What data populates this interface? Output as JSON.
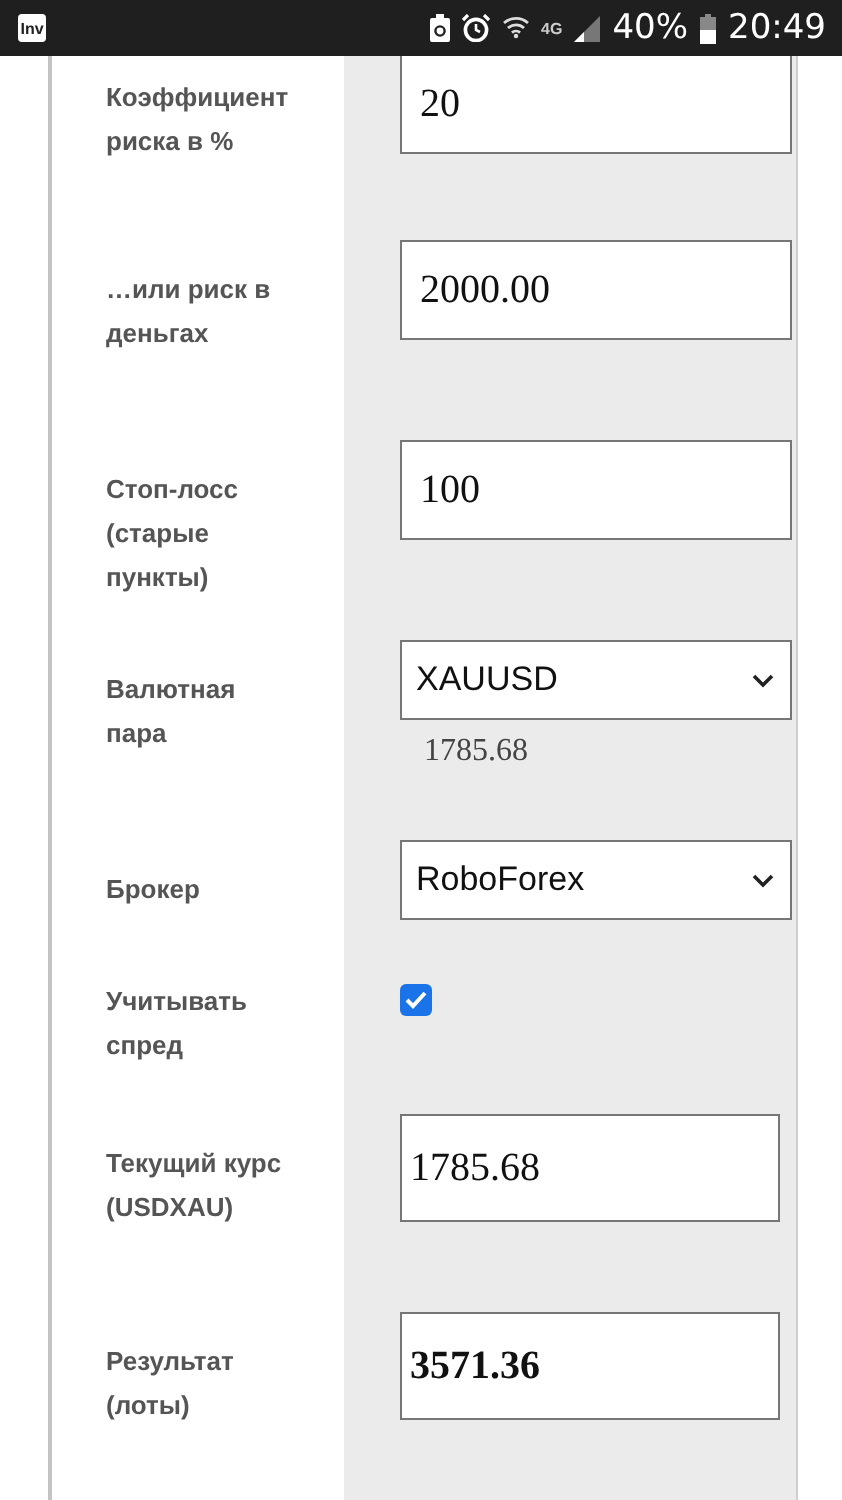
{
  "status_bar": {
    "app_badge": "Inv",
    "network": "4G",
    "battery": "40%",
    "time": "20:49"
  },
  "form": {
    "rows": [
      {
        "kind": "input",
        "label": "Коэффициент риска в %",
        "value": "20"
      },
      {
        "kind": "input",
        "label": "…или риск в деньгах",
        "value": "2000.00"
      },
      {
        "kind": "input",
        "label": "Стоп-лосс (старые пункты)",
        "value": "100"
      },
      {
        "kind": "select",
        "label": "Валютная пара",
        "value": "XAUUSD",
        "note": "1785.68"
      },
      {
        "kind": "select",
        "label": "Брокер",
        "value": "RoboForex"
      },
      {
        "kind": "checkbox",
        "label": "Учитывать спред",
        "checked": true
      },
      {
        "kind": "readonly",
        "label": "Текущий курс (USDXAU)",
        "value": "1785.68"
      },
      {
        "kind": "result",
        "label": "Результат (лоты)",
        "value": "3571.36"
      }
    ]
  }
}
